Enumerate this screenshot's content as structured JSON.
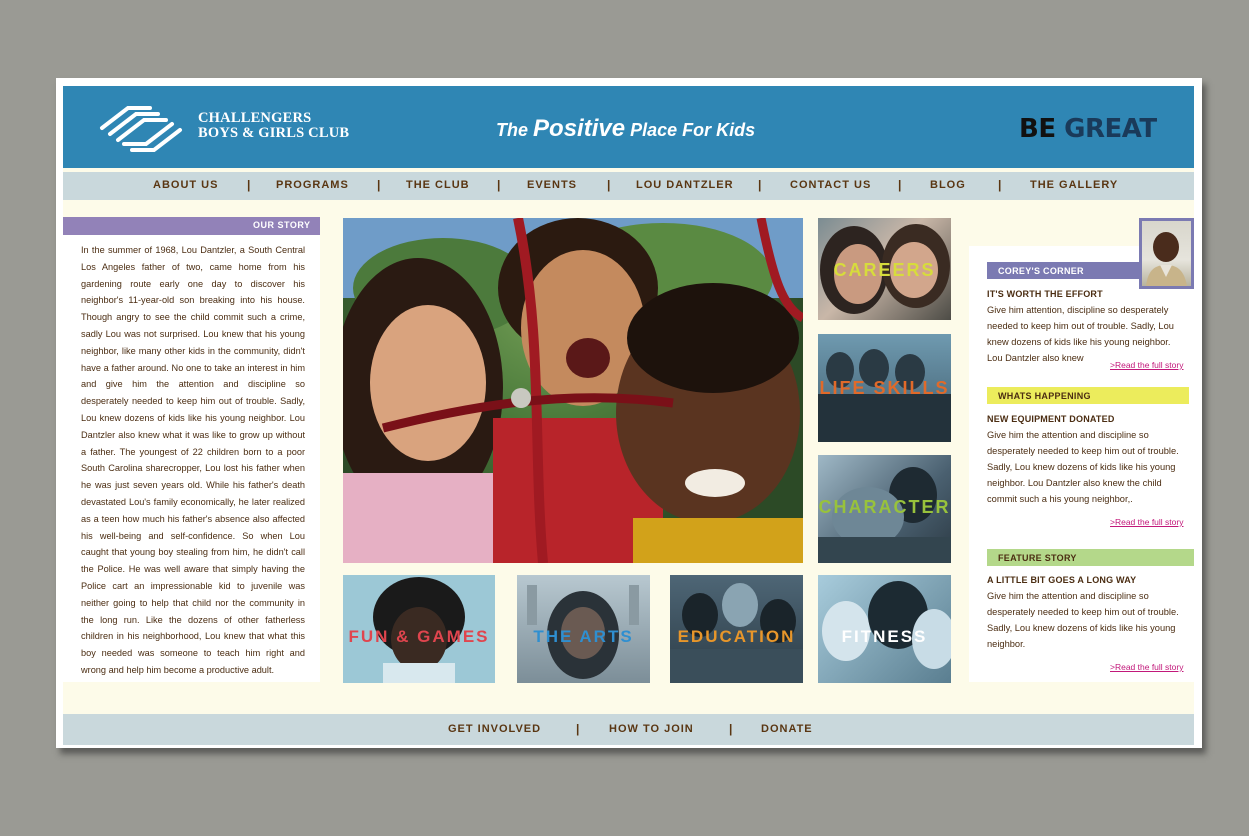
{
  "header": {
    "club_line1": "CHALLENGERS",
    "club_line2": "BOYS & GIRLS CLUB",
    "tagline_the": "The",
    "tagline_positive": "Positive",
    "tagline_rest": "Place For Kids",
    "slogan_be": "BE",
    "slogan_great": "GREAT",
    "brand_color": "#2f86b4"
  },
  "nav": {
    "items": [
      "ABOUT US",
      "PROGRAMS",
      "THE CLUB",
      "EVENTS",
      "LOU DANTZLER",
      "CONTACT US",
      "BLOG",
      "THE GALLERY"
    ],
    "separator": "|"
  },
  "story": {
    "heading": "OUR STORY",
    "body": "In the summer of 1968, Lou Dantzler, a South Central Los Angeles father of two, came home from his gardening route early one day to discover his neighbor's 11-year-old son breaking into his house. Though angry to see the child commit such a crime, sadly Lou was not surprised. Lou knew that his young neighbor, like many other kids in the community, didn't have a father around. No one to take an interest in him and give him the attention and discipline so desperately needed to keep him out of trouble. Sadly, Lou knew dozens of kids like his young neighbor. Lou Dantzler also knew what it was like to grow up without a father. The youngest of 22 children born to a poor South Carolina sharecropper, Lou lost his father when he was just seven years old. While his father's death devastated Lou's family economically, he later realized as a teen how much his father's absence also affected his well-being and self-confidence.  So when Lou caught that young boy stealing from him, he didn't call the Police. He was well aware that simply having the Police cart an impressionable kid to juvenile was neither going to help that child nor the community in the long run. Like the dozens of other fatherless children in his neighborhood, Lou knew that what this boy needed was someone to teach him right and wrong and help him become a productive adult."
  },
  "programs": {
    "careers": {
      "label": "CAREERS",
      "color": "#d7dc3c"
    },
    "life_skills": {
      "label": "LIFE SKILLS",
      "color": "#e06a2a"
    },
    "character": {
      "label": "CHARACTER",
      "color": "#98c23c"
    },
    "fun_games": {
      "label": "FUN & GAMES",
      "color": "#e0454e"
    },
    "the_arts": {
      "label": "THE ARTS",
      "color": "#2f8fd0"
    },
    "education": {
      "label": "EDUCATION",
      "color": "#e8962a"
    },
    "fitness": {
      "label": "FITNESS",
      "color": "#ffffff"
    }
  },
  "sidebar": {
    "coreys_corner": {
      "heading": "COREY'S CORNER",
      "title": "IT'S WORTH THE EFFORT",
      "body": "Give him  attention,  discipline so desperately needed to keep him out of trouble. Sadly, Lou knew dozens of kids like his young neighbor. Lou Dantzler also knew",
      "link": ">Read the full story"
    },
    "whats_happening": {
      "heading": "WHATS HAPPENING",
      "title": "NEW EQUIPMENT DONATED",
      "body": "Give him the attention and discipline so desperately needed to keep him out of trouble. Sadly, Lou knew dozens of kids like his young neighbor. Lou Dantzler also knew the child commit such a  his young neighbor,.",
      "link": ">Read the full story"
    },
    "feature_story": {
      "heading": "FEATURE STORY",
      "title": "A LITTLE BIT GOES A LONG WAY",
      "body": "Give him the attention and discipline so desperately needed to keep him out of trouble. Sadly, Lou knew dozens of kids like his young neighbor.",
      "link": ">Read the full story"
    }
  },
  "footer": {
    "items": [
      "GET INVOLVED",
      "HOW TO JOIN",
      "DONATE"
    ],
    "separator": "|"
  }
}
